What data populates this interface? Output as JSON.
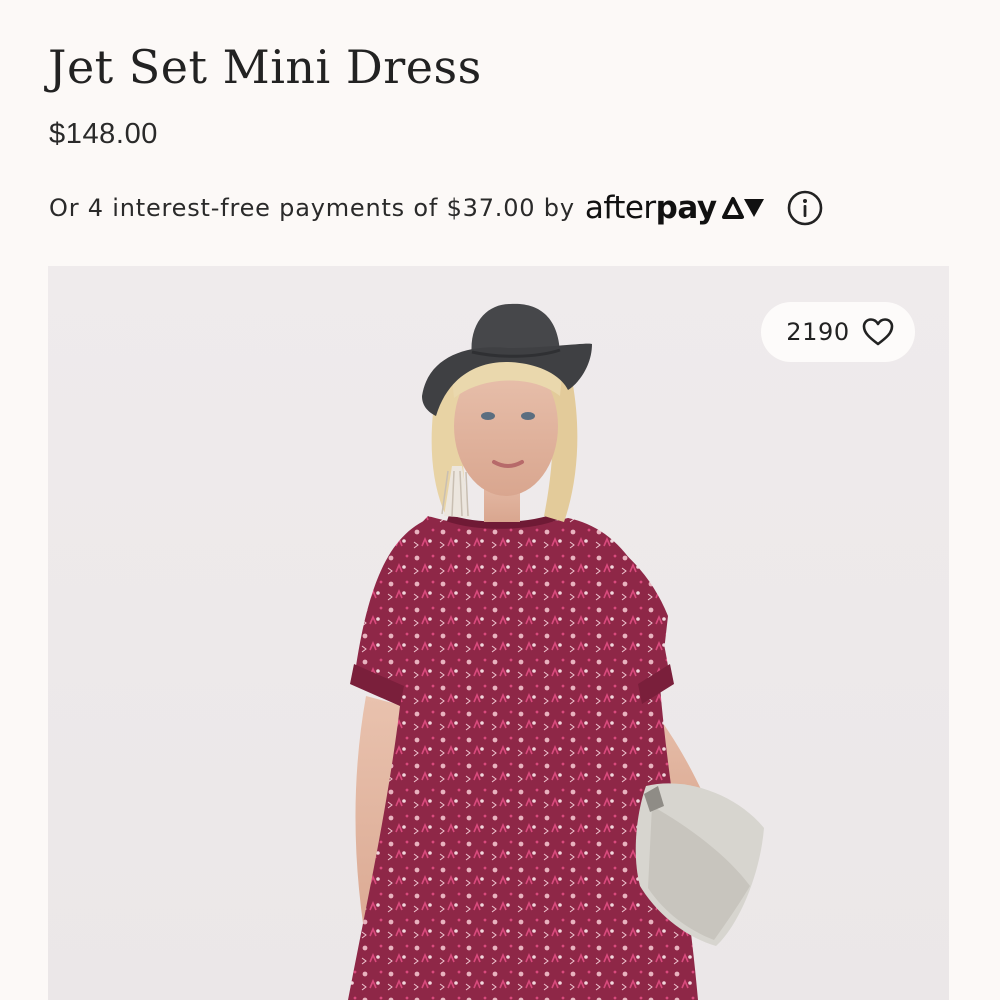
{
  "product": {
    "title": "Jet Set Mini Dress",
    "price": "$148.00"
  },
  "installments": {
    "text": "Or 4 interest-free payments of $37.00 by",
    "provider_after": "after",
    "provider_pay": "pay",
    "info_icon": "info-circle-icon"
  },
  "image": {
    "likes_count": "2190",
    "like_icon": "heart-outline-icon"
  },
  "colors": {
    "background": "#fcf9f7",
    "photo_backdrop": "#eeeaeb",
    "dress": "#8e2747",
    "dress_accent": "#d94a7d",
    "hat": "#3f4043",
    "bag": "#d7d5cf",
    "text": "#222222"
  }
}
